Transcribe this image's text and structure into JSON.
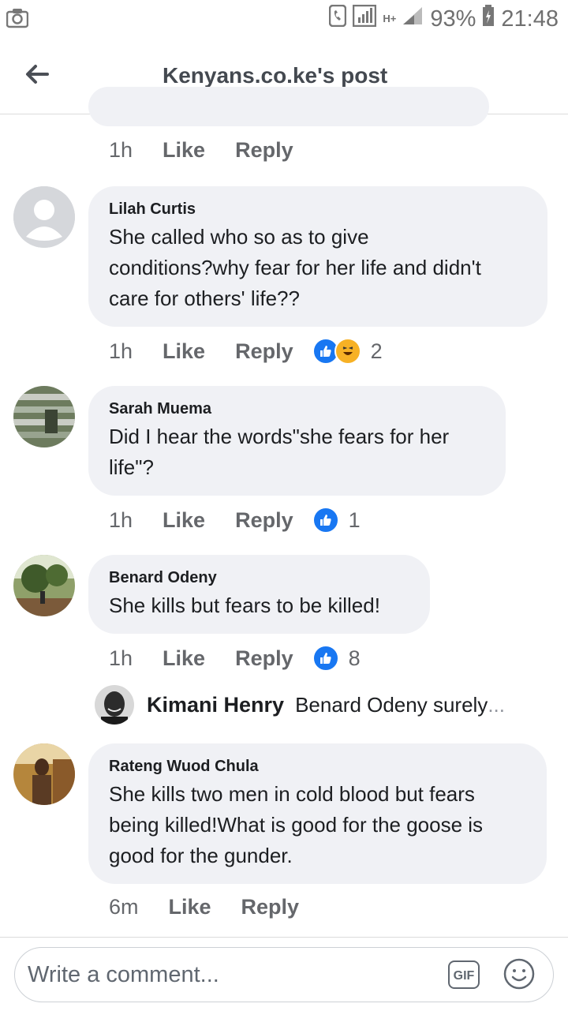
{
  "status_bar": {
    "battery": "93%",
    "time": "21:48",
    "network": "H+"
  },
  "header": {
    "title": "Kenyans.co.ke's post"
  },
  "top_meta": {
    "time": "1h",
    "like": "Like",
    "reply": "Reply"
  },
  "comments": [
    {
      "author": "Lilah Curtis",
      "lines": [
        "She called who so as to give",
        "conditions?why fear for her life and didn't",
        "care for others' life??"
      ],
      "time": "1h",
      "like": "Like",
      "reply": "Reply",
      "reaction_count": "2"
    },
    {
      "author": "Sarah Muema",
      "lines": [
        "Did I hear the words\"she fears for her",
        "life\"?"
      ],
      "time": "1h",
      "like": "Like",
      "reply": "Reply",
      "reaction_count": "1"
    },
    {
      "author": "Benard Odeny",
      "lines": [
        "She kills but fears to be killed!"
      ],
      "time": "1h",
      "like": "Like",
      "reply": "Reply",
      "reaction_count": "8"
    },
    {
      "author": "Rateng Wuod Chula",
      "lines": [
        "She kills two men in cold blood but fears",
        "being killed!What is good for the goose is",
        "good for the gunder."
      ],
      "time": "6m",
      "like": "Like",
      "reply": "Reply"
    }
  ],
  "reply_preview": {
    "name": "Kimani Henry",
    "snippet": "Benard Odeny surely",
    "ellipsis": "..."
  },
  "composer": {
    "placeholder": "Write a comment...",
    "gif_label": "GIF"
  },
  "colors": {
    "bubble": "#f0f1f5",
    "like_blue": "#1877f2",
    "haha_yellow": "#f7b125",
    "meta_gray": "#65676b"
  },
  "icons": [
    "camera-icon",
    "phone-icon",
    "signal-icon",
    "battery-icon",
    "back-arrow-icon",
    "like-reaction-icon",
    "haha-reaction-icon",
    "gif-icon",
    "smiley-icon"
  ]
}
